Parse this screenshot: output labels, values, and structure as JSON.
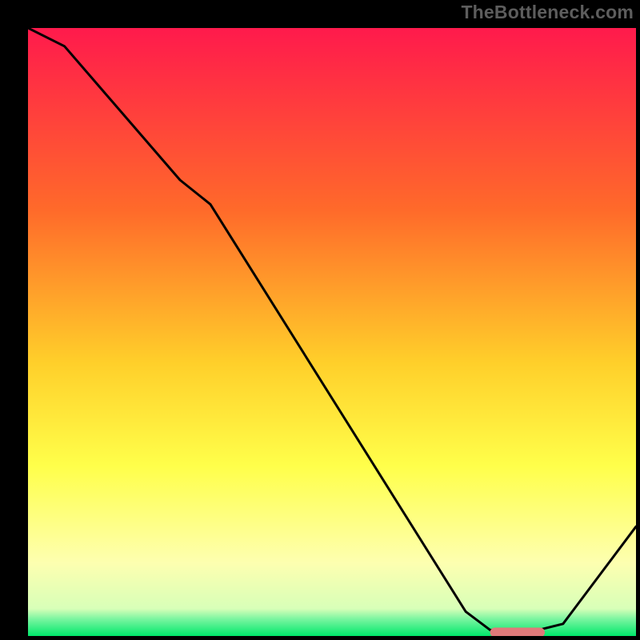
{
  "watermark": "TheBottleneck.com",
  "colors": {
    "gradient_top": "#ff1a4c",
    "gradient_mid1": "#ff8a2a",
    "gradient_mid2": "#ffe93a",
    "gradient_low": "#fcff9a",
    "gradient_bottom": "#00e86b",
    "curve": "#000000",
    "marker": "#e07a7a",
    "frame": "#000000"
  },
  "chart_data": {
    "type": "line",
    "title": "",
    "xlabel": "",
    "ylabel": "",
    "xlim": [
      0,
      100
    ],
    "ylim": [
      0,
      100
    ],
    "series": [
      {
        "name": "bottleneck-curve",
        "x": [
          0,
          6,
          25,
          30,
          72,
          76,
          82,
          88,
          100
        ],
        "values": [
          100,
          97,
          75,
          71,
          4,
          1,
          0.5,
          2,
          18
        ]
      }
    ],
    "marker": {
      "name": "optimal-range",
      "x_start": 76,
      "x_end": 85,
      "y": 0.6
    },
    "gradient_stops": [
      {
        "pos": 0.0,
        "color": "#ff1a4c"
      },
      {
        "pos": 0.3,
        "color": "#ff6a2a"
      },
      {
        "pos": 0.55,
        "color": "#ffcf2a"
      },
      {
        "pos": 0.72,
        "color": "#ffff4a"
      },
      {
        "pos": 0.88,
        "color": "#fdffb0"
      },
      {
        "pos": 0.955,
        "color": "#d8ffb8"
      },
      {
        "pos": 0.972,
        "color": "#7af5a0"
      },
      {
        "pos": 1.0,
        "color": "#00e86b"
      }
    ]
  }
}
